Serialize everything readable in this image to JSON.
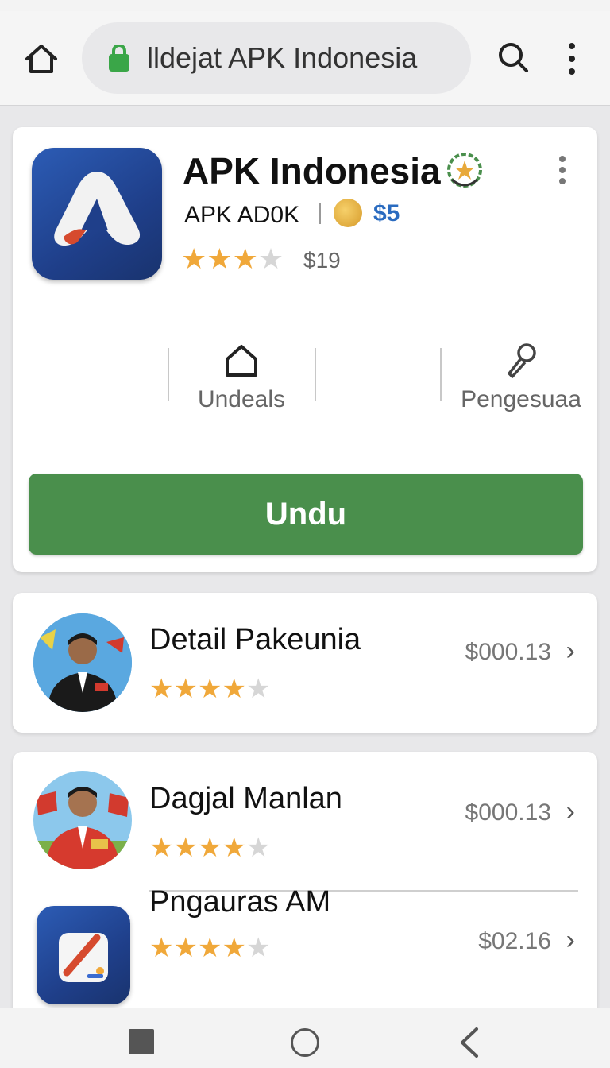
{
  "status_bar": {
    "text": " "
  },
  "browser": {
    "url_text": "lldejat APK Indonesia",
    "icons": {
      "home": "home-icon",
      "lock": "lock-icon",
      "search": "search-icon",
      "menu": "more-vertical-icon"
    }
  },
  "app": {
    "title": "APK Indonesia",
    "developer": "APK AD0K",
    "price": "$5",
    "rating": 3,
    "rating_max": 5,
    "rating_count": "$19",
    "features": [
      {
        "label": "Undeals",
        "icon": "house-icon"
      },
      {
        "label": "Pengesuaa",
        "icon": "pin-icon"
      }
    ],
    "download_label": "Undu",
    "colors": {
      "download": "#4a8f4c",
      "icon_bg": "#1f3f8a",
      "price": "#2a6bc0",
      "star": "#f0a83a"
    }
  },
  "list": [
    {
      "title": "Detail Pakeunia",
      "price": "$000.13",
      "rating": 3.5
    },
    {
      "title": "Dagjal Manlan",
      "price": "$000.13",
      "rating": 3.5
    },
    {
      "title": "Pngauras AM",
      "price": "$02.16",
      "rating": 3.5
    }
  ],
  "nav": {
    "icons": [
      "recent-apps-icon",
      "home-circle-icon",
      "back-icon"
    ]
  }
}
